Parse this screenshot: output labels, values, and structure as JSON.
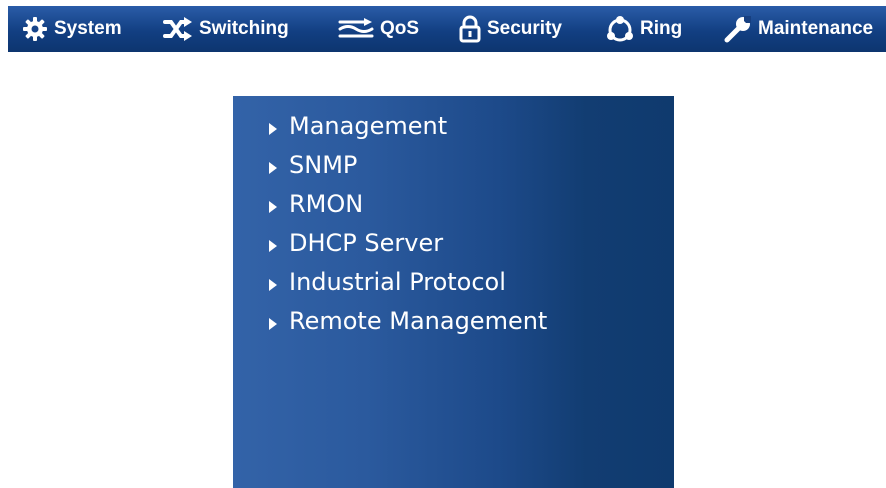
{
  "navbar": {
    "items": [
      {
        "label": "System",
        "icon": "gear-icon"
      },
      {
        "label": "Switching",
        "icon": "shuffle-icon"
      },
      {
        "label": "QoS",
        "icon": "qos-lines-icon"
      },
      {
        "label": "Security",
        "icon": "lock-icon"
      },
      {
        "label": "Ring",
        "icon": "ring-icon"
      },
      {
        "label": "Maintenance",
        "icon": "wrench-icon"
      }
    ]
  },
  "menu": {
    "items": [
      {
        "label": "Management"
      },
      {
        "label": "SNMP"
      },
      {
        "label": "RMON"
      },
      {
        "label": "DHCP Server"
      },
      {
        "label": "Industrial Protocol"
      },
      {
        "label": "Remote Management"
      }
    ]
  },
  "colors": {
    "nav_top": "#2a5ca8",
    "nav_bottom": "#0d356f",
    "panel_left": "#3363a8",
    "panel_right": "#0f3a6e",
    "text": "#ffffff"
  }
}
